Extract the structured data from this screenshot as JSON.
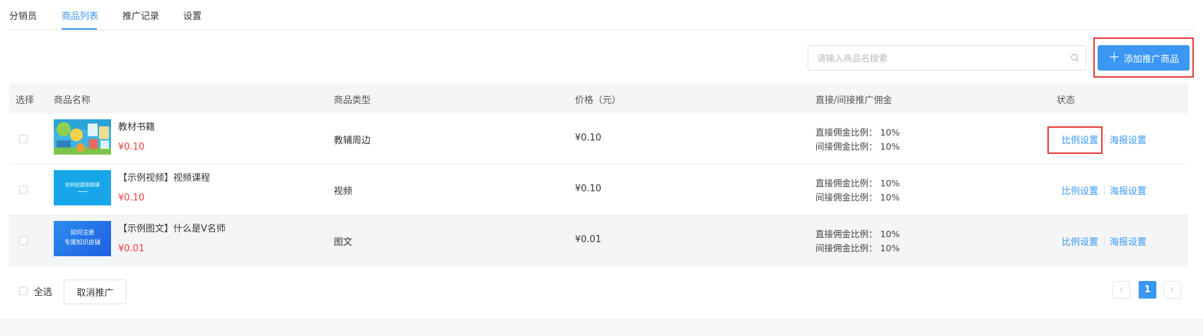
{
  "tabs": [
    {
      "label": "分销员",
      "active": false
    },
    {
      "label": "商品列表",
      "active": true
    },
    {
      "label": "推广记录",
      "active": false
    },
    {
      "label": "设置",
      "active": false
    }
  ],
  "search": {
    "placeholder": "请输入商品名搜索",
    "value": "",
    "icon": "search-icon"
  },
  "add_button": {
    "label": "添加推广商品",
    "icon": "plus-icon"
  },
  "table": {
    "headers": [
      "选择",
      "商品名称",
      "商品类型",
      "价格（元）",
      "直接/间接推广佣金",
      "状态"
    ],
    "rows": [
      {
        "name": "教材书籍",
        "price_tag": "¥0.10",
        "type": "教辅周边",
        "price": "¥0.10",
        "direct": "直接佣金比例： 10%",
        "indirect": "间接佣金比例： 10%",
        "action1": "比例设置",
        "action2": "海报设置"
      },
      {
        "name": "【示例视频】视频课程",
        "price_tag": "¥0.10",
        "type": "视频",
        "price": "¥0.10",
        "direct": "直接佣金比例： 10%",
        "indirect": "间接佣金比例： 10%",
        "action1": "比例设置",
        "action2": "海报设置",
        "thumb_text": "如何创建视频课"
      },
      {
        "name": "【示例图文】什么是V名师",
        "price_tag": "¥0.01",
        "type": "图文",
        "price": "¥0.01",
        "direct": "直接佣金比例： 10%",
        "indirect": "间接佣金比例： 10%",
        "action1": "比例设置",
        "action2": "海报设置",
        "thumb_line1": "如何注册",
        "thumb_line2": "专属知识店铺"
      }
    ]
  },
  "footer": {
    "select_all": "全选",
    "cancel_button": "取消推广",
    "pagination": {
      "current": "1",
      "prev_icon": "chevron-left-icon",
      "next_icon": "chevron-right-icon"
    }
  },
  "colors": {
    "accent": "#3a97f4",
    "price_red": "#f43a3a",
    "highlight_red": "#e53935"
  }
}
